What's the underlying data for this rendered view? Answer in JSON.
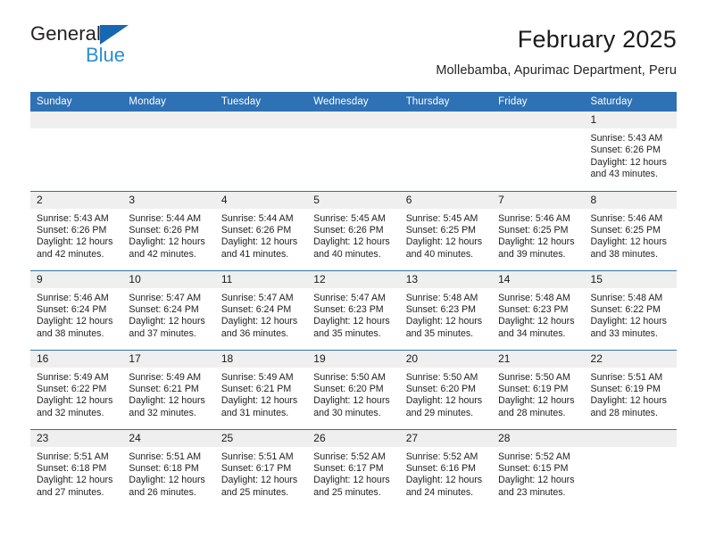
{
  "brand": {
    "name_part1": "General",
    "name_part2": "Blue",
    "triangle_color": "#1668b3",
    "blue_color": "#2a8fd4"
  },
  "header": {
    "title": "February 2025",
    "subtitle": "Mollebamba, Apurimac Department, Peru"
  },
  "colors": {
    "header_blue": "#2e71b5",
    "daynum_band": "#efefef",
    "row_divider": "#2e71b5",
    "text": "#1a1a1a"
  },
  "calendar": {
    "weekday_headers": [
      "Sunday",
      "Monday",
      "Tuesday",
      "Wednesday",
      "Thursday",
      "Friday",
      "Saturday"
    ],
    "labels": {
      "sunrise_prefix": "Sunrise:",
      "sunset_prefix": "Sunset:",
      "daylight_prefix": "Daylight:"
    },
    "weeks": [
      [
        {
          "day": "",
          "sunrise": "",
          "sunset": "",
          "daylight": "",
          "blank": true
        },
        {
          "day": "",
          "sunrise": "",
          "sunset": "",
          "daylight": "",
          "blank": true
        },
        {
          "day": "",
          "sunrise": "",
          "sunset": "",
          "daylight": "",
          "blank": true
        },
        {
          "day": "",
          "sunrise": "",
          "sunset": "",
          "daylight": "",
          "blank": true
        },
        {
          "day": "",
          "sunrise": "",
          "sunset": "",
          "daylight": "",
          "blank": true
        },
        {
          "day": "",
          "sunrise": "",
          "sunset": "",
          "daylight": "",
          "blank": true
        },
        {
          "day": "1",
          "sunrise": "Sunrise: 5:43 AM",
          "sunset": "Sunset: 6:26 PM",
          "daylight": "Daylight: 12 hours and 43 minutes.",
          "blank": false
        }
      ],
      [
        {
          "day": "2",
          "sunrise": "Sunrise: 5:43 AM",
          "sunset": "Sunset: 6:26 PM",
          "daylight": "Daylight: 12 hours and 42 minutes.",
          "blank": false
        },
        {
          "day": "3",
          "sunrise": "Sunrise: 5:44 AM",
          "sunset": "Sunset: 6:26 PM",
          "daylight": "Daylight: 12 hours and 42 minutes.",
          "blank": false
        },
        {
          "day": "4",
          "sunrise": "Sunrise: 5:44 AM",
          "sunset": "Sunset: 6:26 PM",
          "daylight": "Daylight: 12 hours and 41 minutes.",
          "blank": false
        },
        {
          "day": "5",
          "sunrise": "Sunrise: 5:45 AM",
          "sunset": "Sunset: 6:26 PM",
          "daylight": "Daylight: 12 hours and 40 minutes.",
          "blank": false
        },
        {
          "day": "6",
          "sunrise": "Sunrise: 5:45 AM",
          "sunset": "Sunset: 6:25 PM",
          "daylight": "Daylight: 12 hours and 40 minutes.",
          "blank": false
        },
        {
          "day": "7",
          "sunrise": "Sunrise: 5:46 AM",
          "sunset": "Sunset: 6:25 PM",
          "daylight": "Daylight: 12 hours and 39 minutes.",
          "blank": false
        },
        {
          "day": "8",
          "sunrise": "Sunrise: 5:46 AM",
          "sunset": "Sunset: 6:25 PM",
          "daylight": "Daylight: 12 hours and 38 minutes.",
          "blank": false
        }
      ],
      [
        {
          "day": "9",
          "sunrise": "Sunrise: 5:46 AM",
          "sunset": "Sunset: 6:24 PM",
          "daylight": "Daylight: 12 hours and 38 minutes.",
          "blank": false
        },
        {
          "day": "10",
          "sunrise": "Sunrise: 5:47 AM",
          "sunset": "Sunset: 6:24 PM",
          "daylight": "Daylight: 12 hours and 37 minutes.",
          "blank": false
        },
        {
          "day": "11",
          "sunrise": "Sunrise: 5:47 AM",
          "sunset": "Sunset: 6:24 PM",
          "daylight": "Daylight: 12 hours and 36 minutes.",
          "blank": false
        },
        {
          "day": "12",
          "sunrise": "Sunrise: 5:47 AM",
          "sunset": "Sunset: 6:23 PM",
          "daylight": "Daylight: 12 hours and 35 minutes.",
          "blank": false
        },
        {
          "day": "13",
          "sunrise": "Sunrise: 5:48 AM",
          "sunset": "Sunset: 6:23 PM",
          "daylight": "Daylight: 12 hours and 35 minutes.",
          "blank": false
        },
        {
          "day": "14",
          "sunrise": "Sunrise: 5:48 AM",
          "sunset": "Sunset: 6:23 PM",
          "daylight": "Daylight: 12 hours and 34 minutes.",
          "blank": false
        },
        {
          "day": "15",
          "sunrise": "Sunrise: 5:48 AM",
          "sunset": "Sunset: 6:22 PM",
          "daylight": "Daylight: 12 hours and 33 minutes.",
          "blank": false
        }
      ],
      [
        {
          "day": "16",
          "sunrise": "Sunrise: 5:49 AM",
          "sunset": "Sunset: 6:22 PM",
          "daylight": "Daylight: 12 hours and 32 minutes.",
          "blank": false
        },
        {
          "day": "17",
          "sunrise": "Sunrise: 5:49 AM",
          "sunset": "Sunset: 6:21 PM",
          "daylight": "Daylight: 12 hours and 32 minutes.",
          "blank": false
        },
        {
          "day": "18",
          "sunrise": "Sunrise: 5:49 AM",
          "sunset": "Sunset: 6:21 PM",
          "daylight": "Daylight: 12 hours and 31 minutes.",
          "blank": false
        },
        {
          "day": "19",
          "sunrise": "Sunrise: 5:50 AM",
          "sunset": "Sunset: 6:20 PM",
          "daylight": "Daylight: 12 hours and 30 minutes.",
          "blank": false
        },
        {
          "day": "20",
          "sunrise": "Sunrise: 5:50 AM",
          "sunset": "Sunset: 6:20 PM",
          "daylight": "Daylight: 12 hours and 29 minutes.",
          "blank": false
        },
        {
          "day": "21",
          "sunrise": "Sunrise: 5:50 AM",
          "sunset": "Sunset: 6:19 PM",
          "daylight": "Daylight: 12 hours and 28 minutes.",
          "blank": false
        },
        {
          "day": "22",
          "sunrise": "Sunrise: 5:51 AM",
          "sunset": "Sunset: 6:19 PM",
          "daylight": "Daylight: 12 hours and 28 minutes.",
          "blank": false
        }
      ],
      [
        {
          "day": "23",
          "sunrise": "Sunrise: 5:51 AM",
          "sunset": "Sunset: 6:18 PM",
          "daylight": "Daylight: 12 hours and 27 minutes.",
          "blank": false
        },
        {
          "day": "24",
          "sunrise": "Sunrise: 5:51 AM",
          "sunset": "Sunset: 6:18 PM",
          "daylight": "Daylight: 12 hours and 26 minutes.",
          "blank": false
        },
        {
          "day": "25",
          "sunrise": "Sunrise: 5:51 AM",
          "sunset": "Sunset: 6:17 PM",
          "daylight": "Daylight: 12 hours and 25 minutes.",
          "blank": false
        },
        {
          "day": "26",
          "sunrise": "Sunrise: 5:52 AM",
          "sunset": "Sunset: 6:17 PM",
          "daylight": "Daylight: 12 hours and 25 minutes.",
          "blank": false
        },
        {
          "day": "27",
          "sunrise": "Sunrise: 5:52 AM",
          "sunset": "Sunset: 6:16 PM",
          "daylight": "Daylight: 12 hours and 24 minutes.",
          "blank": false
        },
        {
          "day": "28",
          "sunrise": "Sunrise: 5:52 AM",
          "sunset": "Sunset: 6:15 PM",
          "daylight": "Daylight: 12 hours and 23 minutes.",
          "blank": false
        },
        {
          "day": "",
          "sunrise": "",
          "sunset": "",
          "daylight": "",
          "blank": true
        }
      ]
    ]
  }
}
